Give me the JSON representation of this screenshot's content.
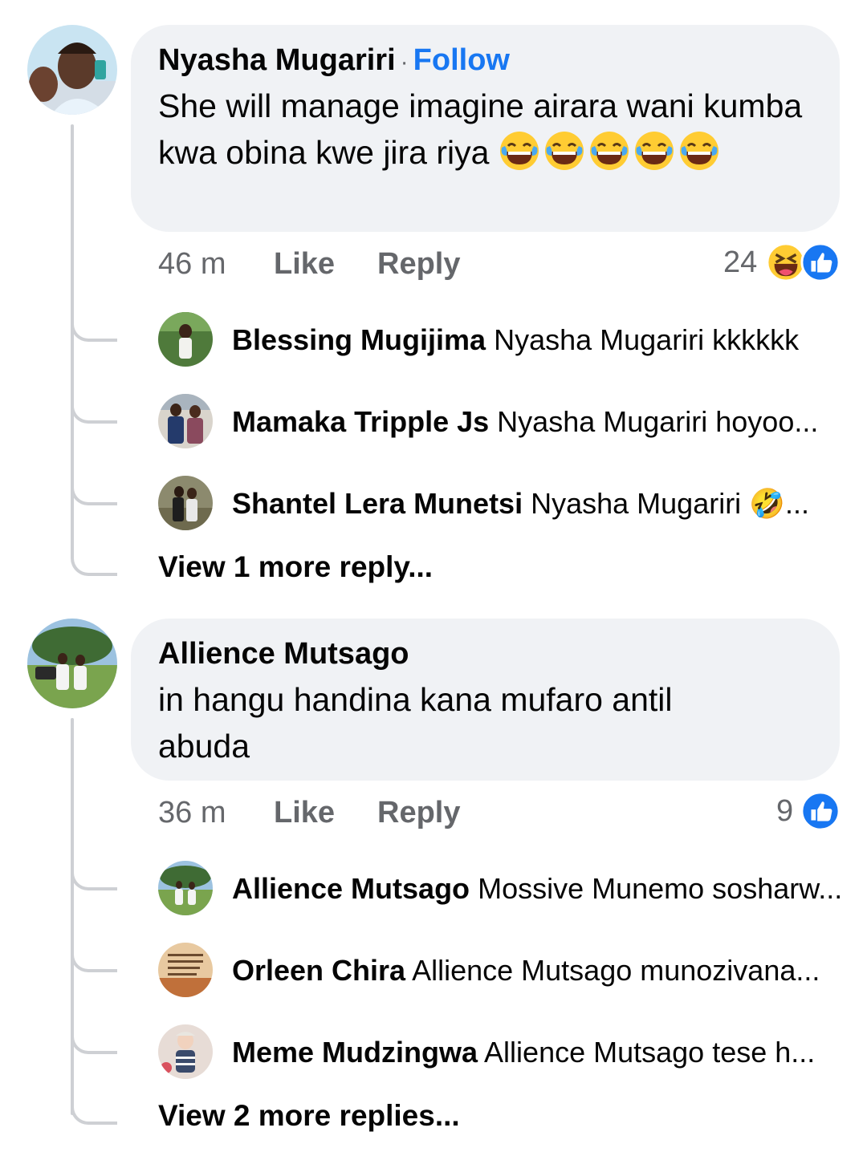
{
  "comments": [
    {
      "author": "Nyasha Mugariri",
      "follow_label": "Follow",
      "text": "She will manage imagine airara wani kumba kwa obina kwe jira riya",
      "time": "46 m",
      "like_label": "Like",
      "reply_label": "Reply",
      "reaction_count": "24",
      "reactions": [
        "laughing-squint-icon",
        "like-thumb-icon"
      ],
      "replies": [
        {
          "name": "Blessing Mugijima",
          "text": "Nyasha Mugariri kkkkkk"
        },
        {
          "name": "Mamaka Tripple Js",
          "text": "Nyasha Mugariri hoyoo..."
        },
        {
          "name": "Shantel Lera Munetsi",
          "text": "Nyasha Mugariri 🤣..."
        }
      ],
      "view_more": "View 1 more reply..."
    },
    {
      "author": "Allience Mutsago",
      "text": "in hangu handina kana mufaro antil abuda",
      "time": "36 m",
      "like_label": "Like",
      "reply_label": "Reply",
      "reaction_count": "9",
      "reactions": [
        "like-thumb-icon"
      ],
      "replies": [
        {
          "name": "Allience Mutsago",
          "text": "Mossive Munemo sosharw..."
        },
        {
          "name": "Orleen Chira",
          "text": "Allience Mutsago munozivana..."
        },
        {
          "name": "Meme Mudzingwa",
          "text": "Allience Mutsago tese h..."
        }
      ],
      "view_more": "View 2 more replies..."
    }
  ],
  "colors": {
    "bubble": "#f0f2f5",
    "follow": "#1877f2",
    "meta": "#65676b",
    "thread_line": "#ced0d4",
    "like_blue": "#1877f2",
    "emoji_yellow": "#ffcc33"
  }
}
